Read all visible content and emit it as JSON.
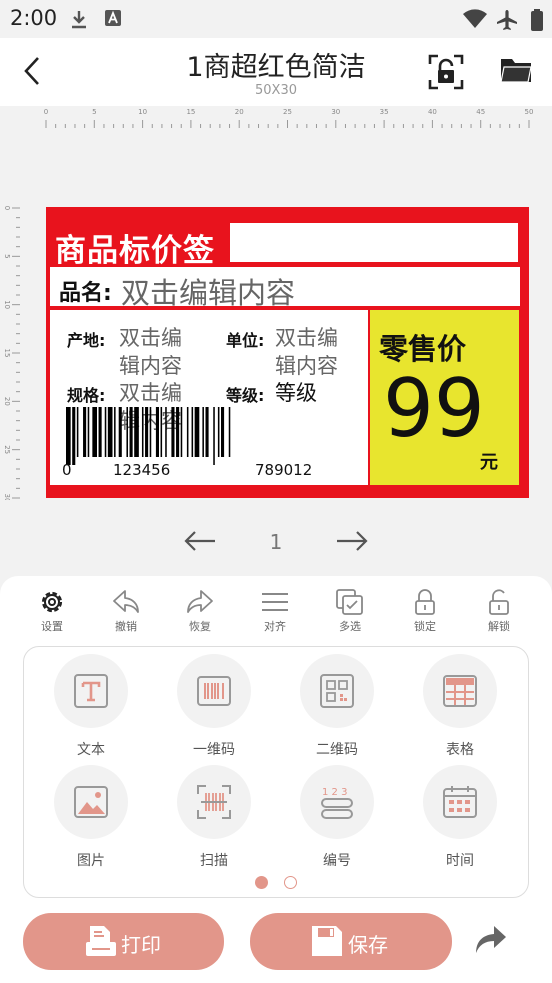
{
  "status_bar": {
    "time": "2:00"
  },
  "header": {
    "title": "1商超红色简洁",
    "subtitle": "50X30"
  },
  "ruler": {
    "h_ticks": [
      "0",
      "5",
      "10",
      "15",
      "20",
      "25",
      "30",
      "35",
      "40",
      "45",
      "50"
    ],
    "v_ticks": [
      "0",
      "5",
      "10",
      "15",
      "20",
      "25",
      "30"
    ]
  },
  "label": {
    "title": "商品标价签",
    "name_prefix": "品名:",
    "name_value": "双击编辑内容",
    "origin_prefix": "产地:",
    "origin_value_1": "双击编",
    "origin_value_2": "辑内容",
    "unit_prefix": "单位:",
    "unit_value_1": "双击编",
    "unit_value_2": "辑内容",
    "spec_prefix": "规格:",
    "spec_value_1": "双击编",
    "spec_value_2": "辑内容",
    "grade_prefix": "等级:",
    "grade_value": "等级",
    "barcode_digits_1": "0",
    "barcode_digits_2": "123456",
    "barcode_digits_3": "789012",
    "retail_label": "零售价",
    "price": "99",
    "currency": "元",
    "colors": {
      "red": "#e8131d",
      "yellow": "#e8e52e"
    }
  },
  "pager": {
    "page": "1"
  },
  "toolbar": [
    {
      "label": "设置",
      "icon": "gear-icon"
    },
    {
      "label": "撤销",
      "icon": "undo-icon"
    },
    {
      "label": "恢复",
      "icon": "redo-icon"
    },
    {
      "label": "对齐",
      "icon": "align-icon"
    },
    {
      "label": "多选",
      "icon": "multiselect-icon"
    },
    {
      "label": "锁定",
      "icon": "lock-icon"
    },
    {
      "label": "解锁",
      "icon": "unlock-icon"
    }
  ],
  "elements": [
    {
      "label": "文本",
      "icon": "text-icon"
    },
    {
      "label": "一维码",
      "icon": "barcode-icon"
    },
    {
      "label": "二维码",
      "icon": "qrcode-icon"
    },
    {
      "label": "表格",
      "icon": "table-icon"
    },
    {
      "label": "图片",
      "icon": "image-icon"
    },
    {
      "label": "扫描",
      "icon": "scan-icon"
    },
    {
      "label": "编号",
      "icon": "number-icon"
    },
    {
      "label": "时间",
      "icon": "calendar-icon"
    }
  ],
  "buttons": {
    "print": "打印",
    "save": "保存"
  },
  "accent_color": "#e2968a"
}
